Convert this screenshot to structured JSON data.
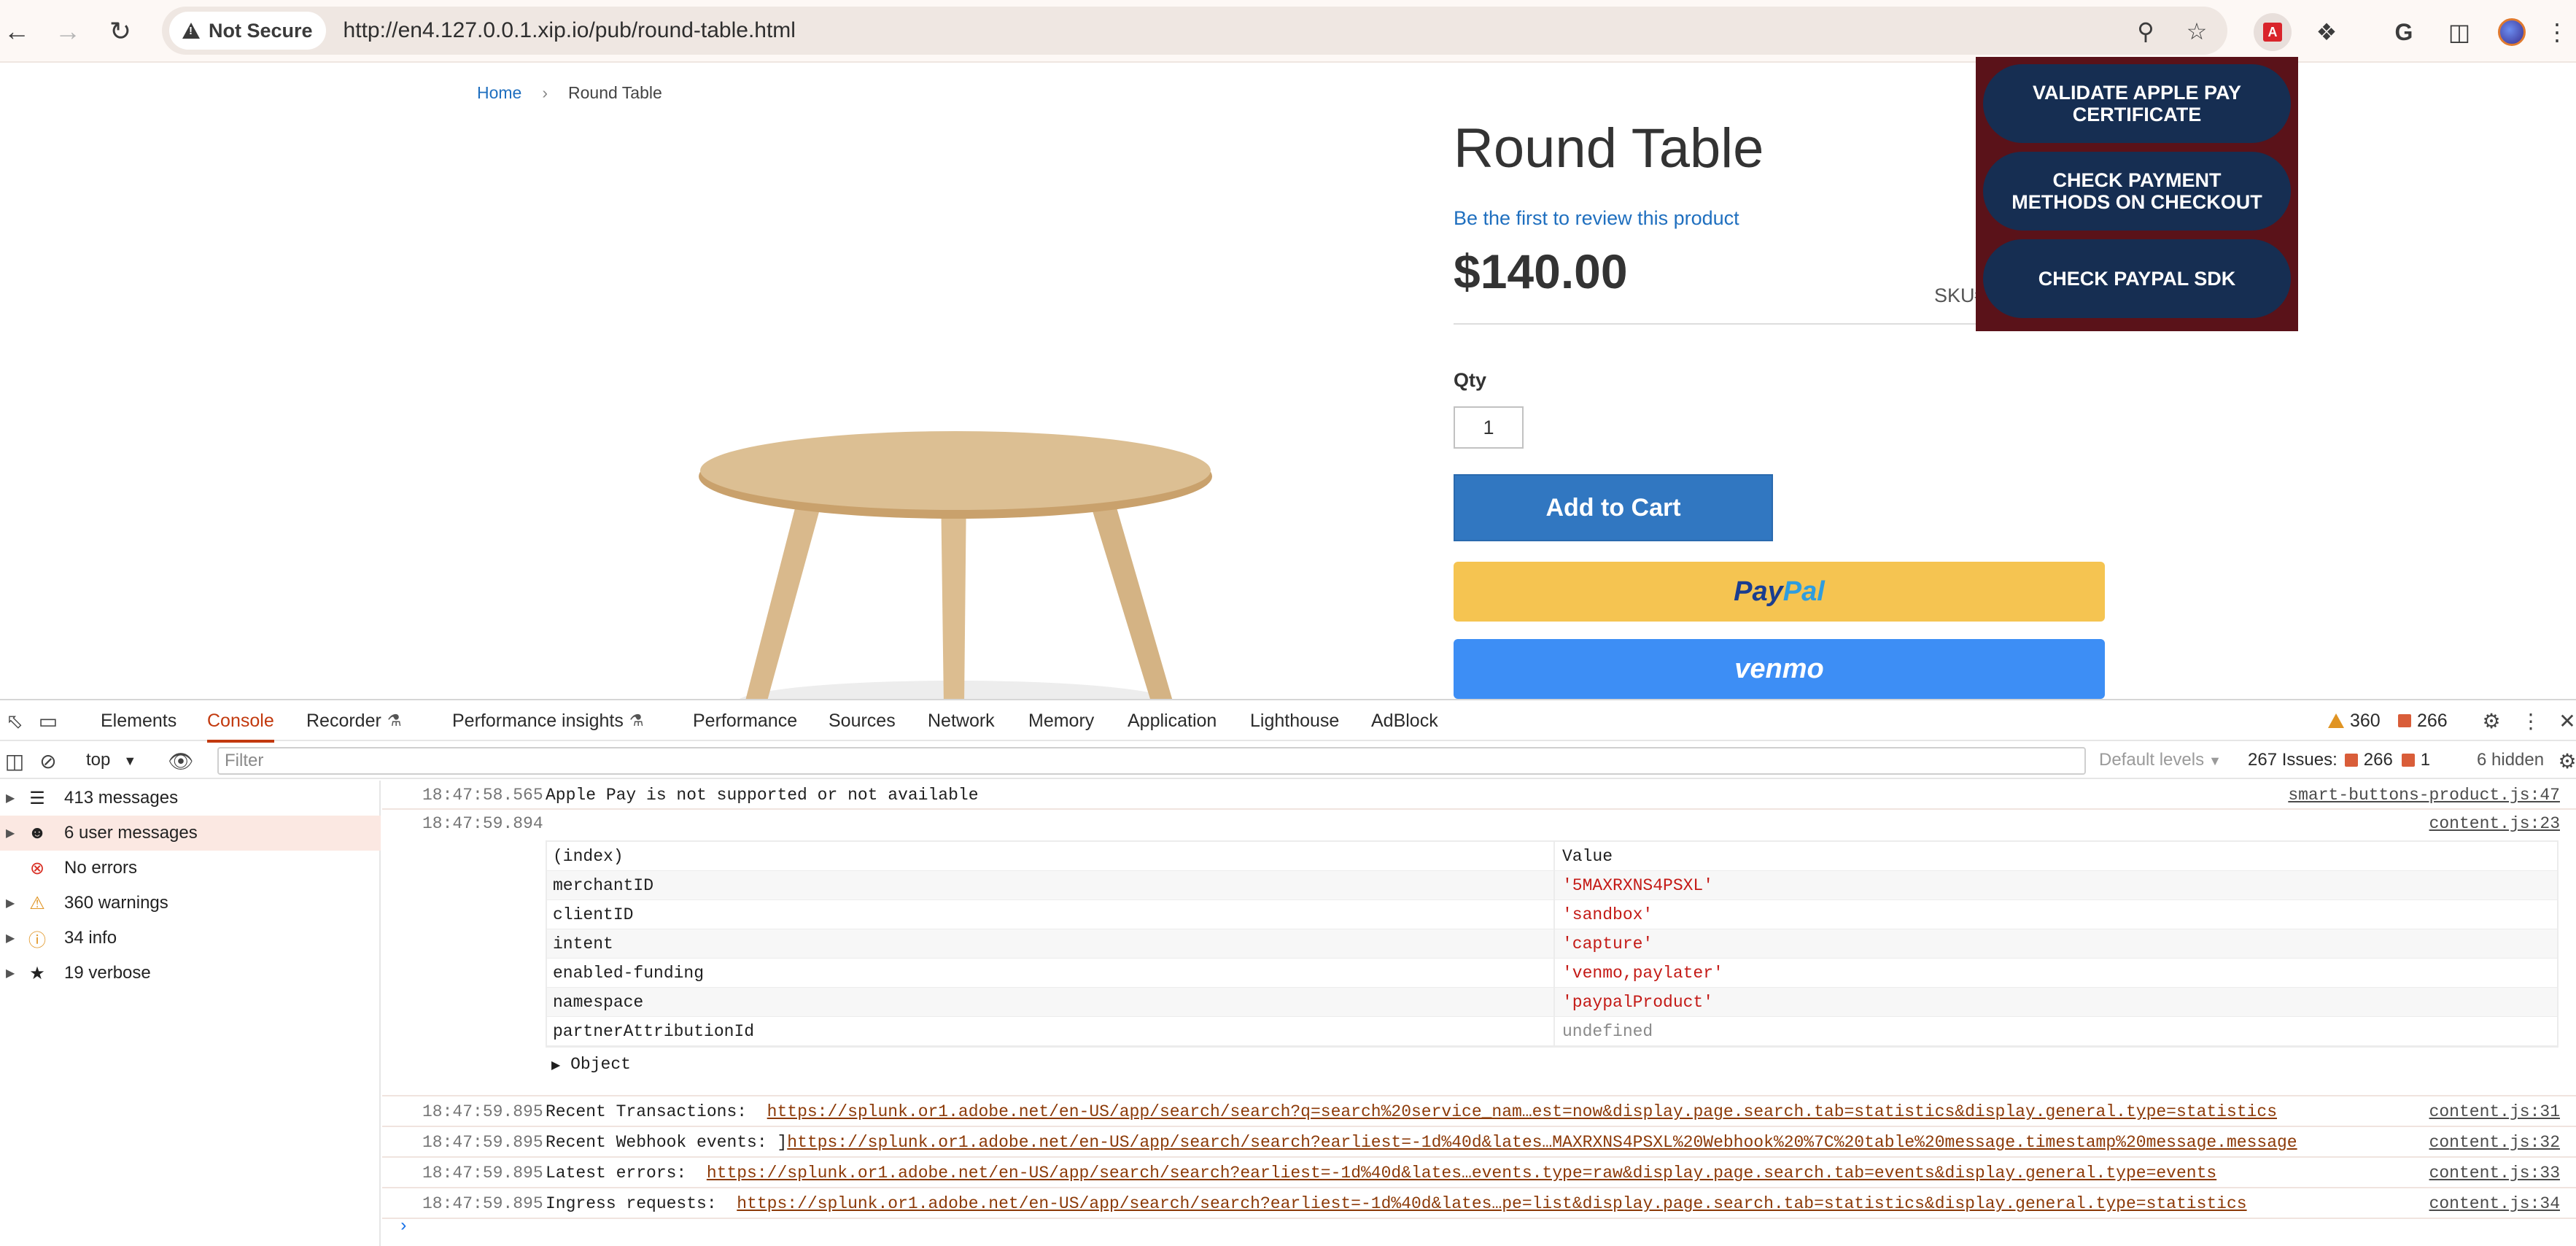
{
  "browser": {
    "security_label": "Not Secure",
    "url": "http://en4.127.0.0.1.xip.io/pub/round-table.html"
  },
  "page": {
    "breadcrumb": {
      "home": "Home",
      "current": "Round Table"
    },
    "title": "Round Table",
    "review_link": "Be the first to review this product",
    "price": "$140.00",
    "sku_label": "SKU#",
    "qty_label": "Qty",
    "qty_value": "1",
    "add_to_cart": "Add to Cart",
    "paypal_pay": "Pay",
    "paypal_pal": "Pal",
    "venmo": "venmo"
  },
  "extension_popup": {
    "buttons": [
      "VALIDATE APPLE PAY CERTIFICATE",
      "CHECK PAYMENT METHODS ON CHECKOUT",
      "CHECK PAYPAL SDK"
    ]
  },
  "devtools": {
    "tabs": [
      "Elements",
      "Console",
      "Recorder",
      "Performance insights",
      "Performance",
      "Sources",
      "Network",
      "Memory",
      "Application",
      "Lighthouse",
      "AdBlock"
    ],
    "active_tab": "Console",
    "warnings_count": "360",
    "issues_count": "266",
    "context": "top",
    "filter_placeholder": "Filter",
    "levels": "Default levels",
    "issues_summary": "267 Issues:",
    "issues_a": "266",
    "issues_b": "1",
    "hidden": "6 hidden",
    "sidebar": [
      {
        "label": "413 messages",
        "icon": "list-icon"
      },
      {
        "label": "6 user messages",
        "icon": "user-icon"
      },
      {
        "label": "No errors",
        "icon": "error-icon"
      },
      {
        "label": "360 warnings",
        "icon": "warning-icon"
      },
      {
        "label": "34 info",
        "icon": "info-icon"
      },
      {
        "label": "19 verbose",
        "icon": "bug-icon"
      }
    ],
    "console": {
      "row1": {
        "ts": "18:47:58.565",
        "msg": "Apple Pay is not supported or not available",
        "src": "smart-buttons-product.js:47"
      },
      "row2": {
        "ts": "18:47:59.894",
        "src": "content.js:23"
      },
      "table": {
        "header_index": "(index)",
        "header_value": "Value",
        "rows": [
          {
            "key": "merchantID",
            "value": "'5MAXRXNS4PSXL'"
          },
          {
            "key": "clientID",
            "value": "'sandbox'"
          },
          {
            "key": "intent",
            "value": "'capture'"
          },
          {
            "key": "enabled-funding",
            "value": "'venmo,paylater'"
          },
          {
            "key": "namespace",
            "value": "'paypalProduct'"
          },
          {
            "key": "partnerAttributionId",
            "value": "undefined"
          }
        ],
        "object_label": "Object"
      },
      "links": [
        {
          "ts": "18:47:59.895",
          "label": "Recent Transactions:",
          "url": "https://splunk.or1.adobe.net/en-US/app/search/search?q=search%20service_nam…est=now&display.page.search.tab=statistics&display.general.type=statistics",
          "src": "content.js:31"
        },
        {
          "ts": "18:47:59.895",
          "label": "Recent Webhook events:  ]",
          "url": "https://splunk.or1.adobe.net/en-US/app/search/search?earliest=-1d%40d&lates…MAXRXNS4PSXL%20Webhook%20%7C%20table%20message.timestamp%20message.message",
          "src": "content.js:32"
        },
        {
          "ts": "18:47:59.895",
          "label": "Latest errors:",
          "url": "https://splunk.or1.adobe.net/en-US/app/search/search?earliest=-1d%40d&lates…events.type=raw&display.page.search.tab=events&display.general.type=events",
          "src": "content.js:33"
        },
        {
          "ts": "18:47:59.895",
          "label": "Ingress requests:",
          "url": "https://splunk.or1.adobe.net/en-US/app/search/search?earliest=-1d%40d&lates…pe=list&display.page.search.tab=statistics&display.general.type=statistics",
          "src": "content.js:34"
        }
      ]
    }
  }
}
